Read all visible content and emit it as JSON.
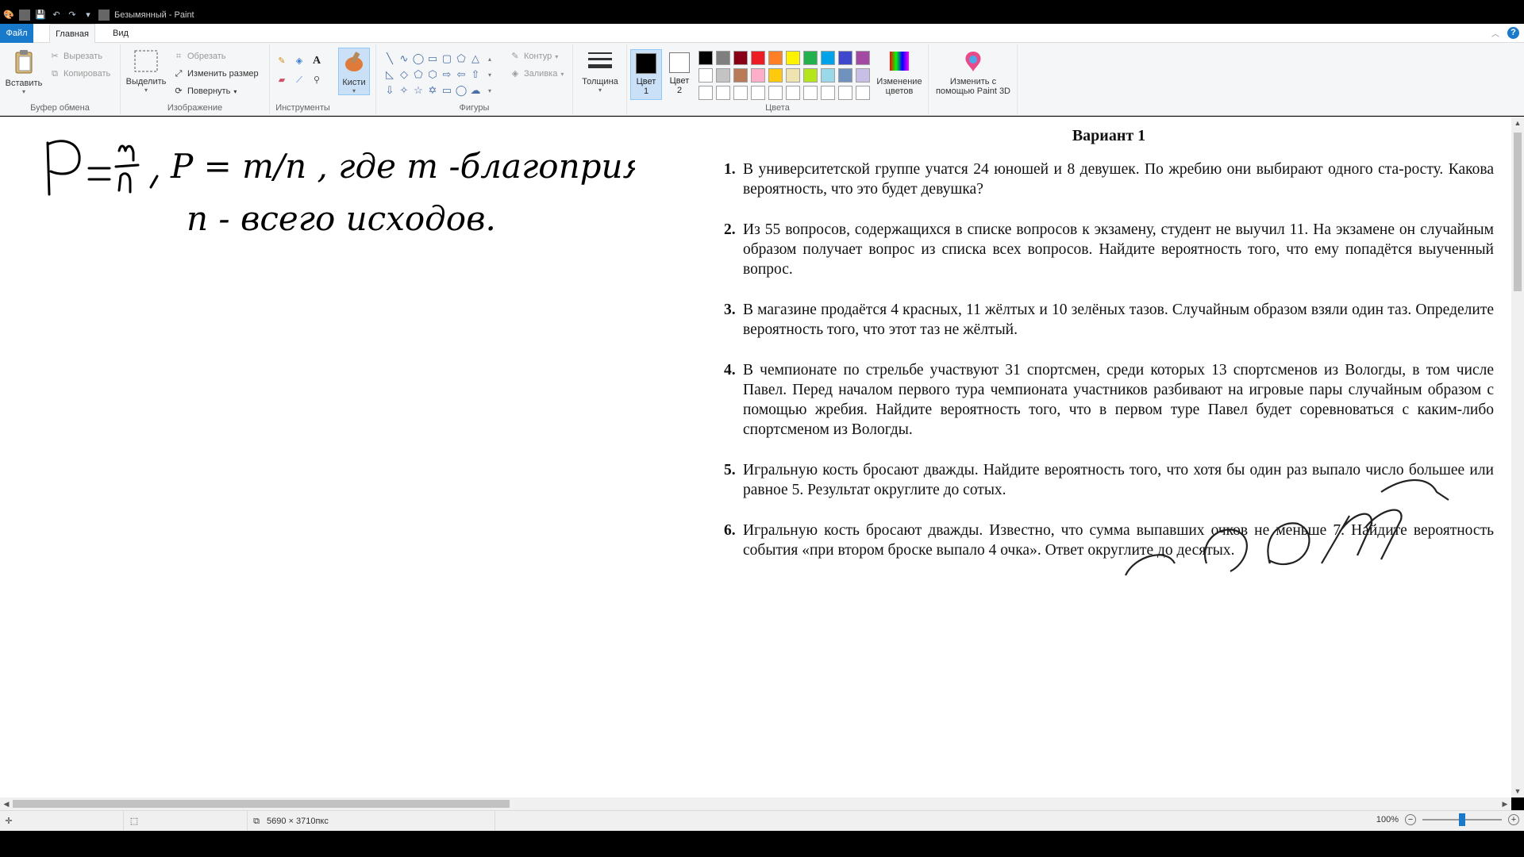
{
  "window": {
    "title": "Безымянный - Paint"
  },
  "tabs": {
    "file": "Файл",
    "home": "Главная",
    "view": "Вид"
  },
  "clipboard": {
    "paste": "Вставить",
    "cut": "Вырезать",
    "copy": "Копировать",
    "label": "Буфер обмена"
  },
  "image": {
    "select": "Выделить",
    "crop": "Обрезать",
    "resize": "Изменить размер",
    "rotate": "Повернуть",
    "label": "Изображение"
  },
  "tools": {
    "label": "Инструменты",
    "text_tool": "A"
  },
  "brushes": {
    "label": "Кисти"
  },
  "shapes": {
    "label": "Фигуры",
    "outline": "Контур",
    "fill": "Заливка"
  },
  "thickness": {
    "label": "Толщина"
  },
  "colors": {
    "color1": "Цвет 1",
    "color2": "Цвет 2",
    "edit": "Изменение цветов",
    "label": "Цвета",
    "palette": [
      "#000000",
      "#7f7f7f",
      "#880015",
      "#ed1c24",
      "#ff7f27",
      "#fff200",
      "#22b14c",
      "#00a2e8",
      "#3f48cc",
      "#a349a4",
      "#ffffff",
      "#c3c3c3",
      "#b97a57",
      "#ffaec9",
      "#ffc90e",
      "#efe4b0",
      "#b5e61d",
      "#99d9ea",
      "#7092be",
      "#c8bfe7",
      "#ffffff",
      "#ffffff",
      "#ffffff",
      "#ffffff",
      "#ffffff",
      "#ffffff",
      "#ffffff",
      "#ffffff",
      "#ffffff",
      "#ffffff"
    ]
  },
  "paint3d": {
    "label": "Изменить с помощью Paint 3D"
  },
  "handwriting": {
    "line1": "P = m/n , где m -благоприятные",
    "line2": "n - всего исходов."
  },
  "document": {
    "title": "Вариант 1",
    "tasks": [
      {
        "num": "1.",
        "text": "В университетской группе учатся 24 юношей и 8 девушек. По жребию они выбирают одного ста-росту. Какова вероятность, что это будет девушка?"
      },
      {
        "num": "2.",
        "text": "Из 55 вопросов, содержащихся в списке вопросов к экзамену, студент не выучил 11. На экзамене он случайным образом получает вопрос из списка всех вопросов. Найдите вероятность того, что ему попадётся выученный вопрос."
      },
      {
        "num": "3.",
        "text": "В магазине продаётся 4 красных, 11 жёлтых и 10 зелёных тазов. Случайным образом взяли один таз. Определите вероятность того, что этот таз не жёлтый."
      },
      {
        "num": "4.",
        "text": "В чемпионате по стрельбе участвуют 31 спортсмен, среди которых 13 спортсменов из Вологды, в том числе Павел. Перед началом первого тура чемпионата участников разбивают на игровые пары случайным образом с помощью жребия. Найдите вероятность того, что в первом туре Павел будет соревноваться с каким-либо спортсменом из Вологды."
      },
      {
        "num": "5.",
        "text": "Игральную кость бросают дважды. Найдите вероятность того, что хотя бы один раз выпало число большее или равное 5. Результат округлите до сотых."
      },
      {
        "num": "6.",
        "text": "Игральную кость бросают дважды. Известно, что сумма выпавших очков не меньше 7. Найдите вероятность события «при втором броске выпало 4 очка». Ответ округлите до десятых."
      }
    ]
  },
  "status": {
    "size": "5690 × 3710пкс",
    "zoom": "100%",
    "zoom_level": 0.5
  }
}
